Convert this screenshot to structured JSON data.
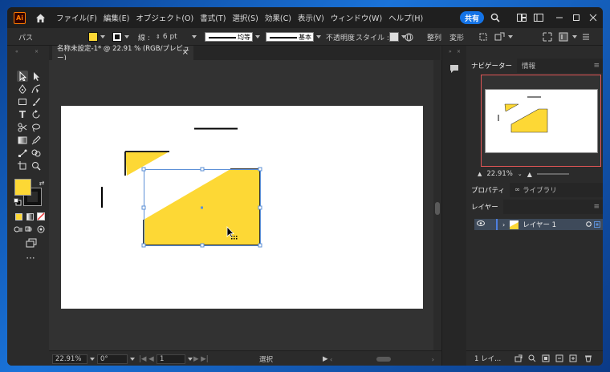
{
  "app": {
    "logo": "Ai"
  },
  "menu": [
    "ファイル(F)",
    "編集(E)",
    "オブジェクト(O)",
    "書式(T)",
    "選択(S)",
    "効果(C)",
    "表示(V)",
    "ウィンドウ(W)",
    "ヘルプ(H)"
  ],
  "share_label": "共有",
  "control": {
    "selection_label": "パス",
    "stroke_label": "線 :",
    "stroke_weight": "6 pt",
    "stroke_profile": "均等",
    "brush": "基本",
    "opacity_label": "不透明度",
    "style_label": "スタイル :",
    "align_label": "整列",
    "transform_label": "変形"
  },
  "document": {
    "tab_title": "名称未設定-1* @ 22.91 % (RGB/プレビュー)",
    "close": "×"
  },
  "status": {
    "zoom": "22.91%",
    "rotation": "0°",
    "artboard": "1",
    "tool": "選択"
  },
  "navigator": {
    "tab": "ナビゲーター",
    "info_tab": "情報",
    "zoom": "22.91%"
  },
  "properties": {
    "tab": "プロパティ",
    "libraries_tab": "ライブラリ"
  },
  "layers": {
    "tab": "レイヤー",
    "layer_name": "レイヤー 1",
    "count": "1 レイ..."
  },
  "colors": {
    "fill": "#fdd835",
    "accent": "#1473e6"
  }
}
